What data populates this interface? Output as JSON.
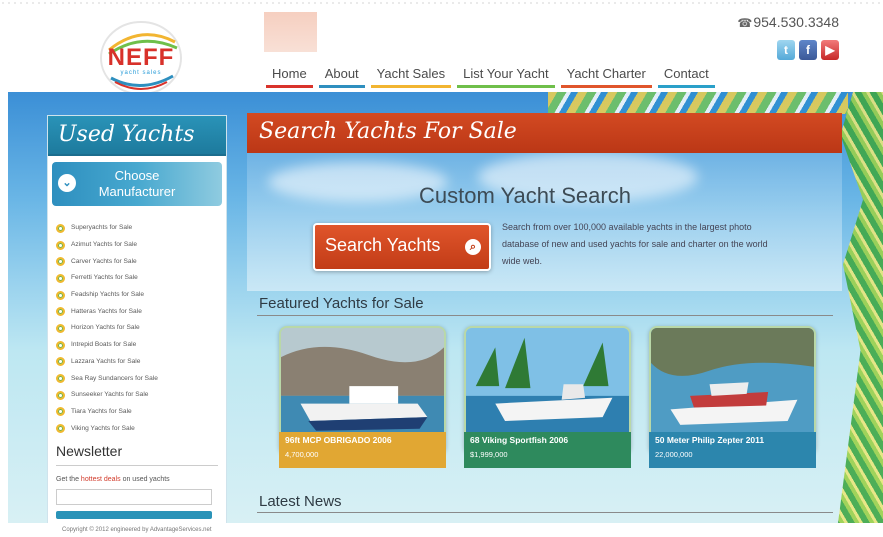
{
  "header": {
    "phone": "954.530.3348",
    "logo_text": "NEFF",
    "logo_sub": "yacht sales",
    "nav": [
      {
        "label": "Home",
        "color": "#d9332b"
      },
      {
        "label": "About",
        "color": "#2e8fbf"
      },
      {
        "label": "Yacht Sales",
        "color": "#f2b531"
      },
      {
        "label": "List Your Yacht",
        "color": "#6fbf4a"
      },
      {
        "label": "Yacht Charter",
        "color": "#e0552b"
      },
      {
        "label": "Contact",
        "color": "#2aa0c9"
      }
    ],
    "social_icons": [
      "twitter-icon",
      "facebook-icon",
      "youtube-icon"
    ]
  },
  "sidebar": {
    "title": "Used Yachts",
    "choose_label": "Choose Manufacturer",
    "items": [
      "Superyachts for Sale",
      "Azimut Yachts for Sale",
      "Carver Yachts for Sale",
      "Ferretti Yachts for Sale",
      "Feadship Yachts for Sale",
      "Hatteras Yachts for Sale",
      "Horizon Yachts for Sale",
      "Intrepid Boats for Sale",
      "Lazzara Yachts for Sale",
      "Sea Ray Sundancers for Sale",
      "Sunseeker Yachts for Sale",
      "Tiara Yachts for Sale",
      "Viking Yachts for Sale"
    ],
    "newsletter_title": "Newsletter",
    "newsletter_pre": "Get the",
    "newsletter_hot": "hottest deals",
    "newsletter_post": "on used yachts"
  },
  "main": {
    "banner": "Search Yachts For Sale",
    "search_heading": "Custom Yacht Search",
    "search_button": "Search Yachts",
    "search_description": "Search from over 100,000 available yachts in the largest photo database of new and used yachts for sale and charter on the world wide web.",
    "featured_title": "Featured Yachts for Sale",
    "latest_title": "Latest News",
    "featured": [
      {
        "title": "96ft MCP OBRIGADO 2006",
        "price": "4,700,000",
        "color": "#e1a733"
      },
      {
        "title": "68 Viking Sportfish 2006",
        "price": "$1,999,000",
        "color": "#2e8a5d"
      },
      {
        "title": "50 Meter Philip Zepter 2011",
        "price": "22,000,000",
        "color": "#2c86ad"
      }
    ]
  },
  "footer": {
    "copyright": "Copyright © 2012 engineered by AdvantageServices.net"
  }
}
